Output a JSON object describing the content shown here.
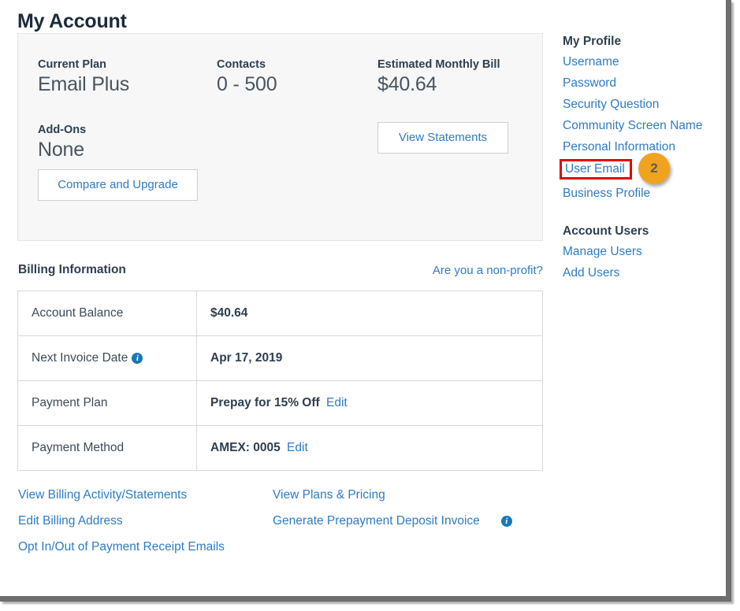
{
  "page": {
    "title": "My Account"
  },
  "plan_card": {
    "current_plan_label": "Current Plan",
    "current_plan_value": "Email Plus",
    "contacts_label": "Contacts",
    "contacts_value": "0 - 500",
    "bill_label": "Estimated Monthly Bill",
    "bill_value": "$40.64",
    "addons_label": "Add-Ons",
    "addons_value": "None",
    "compare_button": "Compare and Upgrade",
    "statements_button": "View Statements"
  },
  "billing": {
    "heading": "Billing Information",
    "nonprofit_link": "Are you a non-profit?",
    "rows": [
      {
        "label": "Account Balance",
        "value": "$40.64",
        "info": false,
        "edit": ""
      },
      {
        "label": "Next Invoice Date",
        "value": "Apr 17, 2019",
        "info": true,
        "edit": ""
      },
      {
        "label": "Payment Plan",
        "value": "Prepay for 15% Off",
        "info": false,
        "edit": "Edit"
      },
      {
        "label": "Payment Method",
        "value": "AMEX: 0005",
        "info": false,
        "edit": "Edit"
      }
    ]
  },
  "footer": {
    "column_a": [
      "View Billing Activity/Statements",
      "Edit Billing Address",
      "Opt In/Out of Payment Receipt Emails"
    ],
    "column_b": [
      "View Plans & Pricing",
      "Generate Prepayment Deposit Invoice"
    ]
  },
  "sidebar": {
    "profile_heading": "My Profile",
    "profile_links": [
      "Username",
      "Password",
      "Security Question",
      "Community Screen Name",
      "Personal Information"
    ],
    "highlighted_link": "User Email",
    "highlight_badge": "2",
    "profile_links_after": [
      "Business Profile"
    ],
    "users_heading": "Account Users",
    "users_links": [
      "Manage Users",
      "Add Users"
    ]
  },
  "icons": {
    "info": "i"
  },
  "colors": {
    "link": "#2e7cc4",
    "heading": "#2e3f50",
    "callout_border": "#e60000",
    "badge_bg": "#f0a31e",
    "card_bg": "#f7f7f7",
    "frame": "#6e6e6e"
  }
}
